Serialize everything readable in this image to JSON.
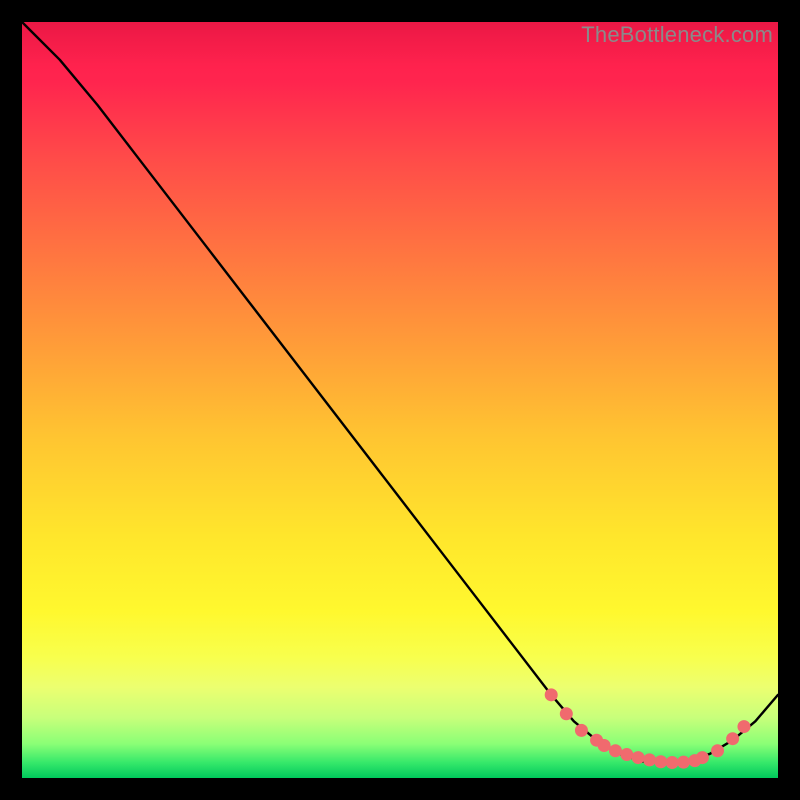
{
  "watermark": "TheBottleneck.com",
  "chart_data": {
    "type": "line",
    "title": "",
    "xlabel": "",
    "ylabel": "",
    "xlim": [
      0,
      100
    ],
    "ylim": [
      0,
      100
    ],
    "series": [
      {
        "name": "curve",
        "x": [
          0,
          5,
          10,
          15,
          20,
          25,
          30,
          35,
          40,
          45,
          50,
          55,
          60,
          65,
          70,
          73,
          76,
          79,
          82,
          85,
          88,
          91,
          94,
          97,
          100
        ],
        "y": [
          100,
          95,
          89,
          82.5,
          76,
          69.5,
          63,
          56.5,
          50,
          43.5,
          37,
          30.5,
          24,
          17.5,
          11,
          7.5,
          5,
          3.2,
          2.2,
          2,
          2.2,
          3.2,
          5,
          7.5,
          11
        ]
      }
    ],
    "markers": {
      "name": "points",
      "x": [
        70,
        72,
        74,
        76,
        77,
        78.5,
        80,
        81.5,
        83,
        84.5,
        86,
        87.5,
        89,
        90,
        92,
        94,
        95.5
      ],
      "y": [
        11,
        8.5,
        6.3,
        5,
        4.3,
        3.6,
        3.1,
        2.7,
        2.4,
        2.15,
        2.05,
        2.1,
        2.3,
        2.7,
        3.6,
        5.2,
        6.8
      ]
    },
    "gradient_stops": [
      {
        "pct": 0,
        "color": "#ff1a4b"
      },
      {
        "pct": 8,
        "color": "#ff254e"
      },
      {
        "pct": 18,
        "color": "#ff4b49"
      },
      {
        "pct": 30,
        "color": "#ff7341"
      },
      {
        "pct": 42,
        "color": "#ff9a39"
      },
      {
        "pct": 55,
        "color": "#ffc531"
      },
      {
        "pct": 68,
        "color": "#ffe62c"
      },
      {
        "pct": 78,
        "color": "#fff82e"
      },
      {
        "pct": 84,
        "color": "#f8ff4d"
      },
      {
        "pct": 88,
        "color": "#ecff70"
      },
      {
        "pct": 92,
        "color": "#c8ff7b"
      },
      {
        "pct": 95.5,
        "color": "#8aff76"
      },
      {
        "pct": 98,
        "color": "#35e86a"
      },
      {
        "pct": 100,
        "color": "#00c95c"
      }
    ],
    "marker_color": "#f06a6e",
    "line_color": "#000000"
  }
}
